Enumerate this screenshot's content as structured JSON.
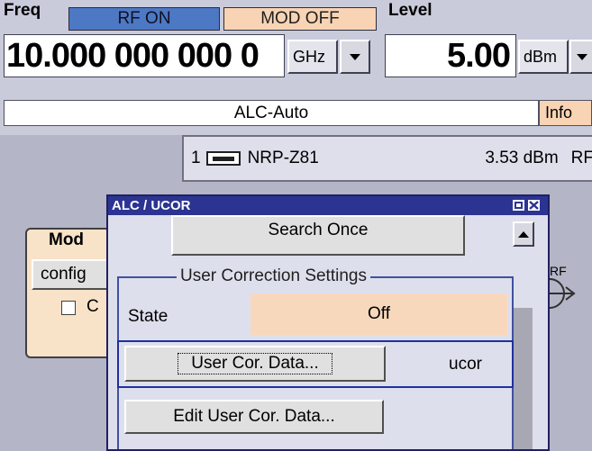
{
  "header": {
    "freq_label": "Freq",
    "rf_status": "RF ON",
    "mod_status": "MOD OFF",
    "level_label": "Level",
    "freq_value": "10.000 000 000 0",
    "freq_unit": "GHz",
    "level_value": "5.00",
    "level_unit": "dBm",
    "alc_status": "ALC-Auto",
    "info_label": "Info"
  },
  "sensor": {
    "index": "1",
    "name": "NRP-Z81",
    "reading": "3.53 dBm",
    "rf_label": "RF"
  },
  "mod_block": {
    "title": "Mod",
    "config_label": "config",
    "checkbox_label": "C"
  },
  "rf_output_label": "RF",
  "dialog": {
    "title": "ALC / UCOR",
    "search_once_label": "Search Once",
    "group_title": "User Correction Settings",
    "state_label": "State",
    "state_value": "Off",
    "user_cor_data_label": "User Cor. Data...",
    "user_cor_data_value": "ucor",
    "edit_user_cor_data_label": "Edit User Cor. Data..."
  },
  "colors": {
    "rf_on_bg": "#4c78c4",
    "mod_off_bg": "#f8d4b4",
    "dialog_title_bg": "#2c3492",
    "group_border": "#4050a0"
  }
}
